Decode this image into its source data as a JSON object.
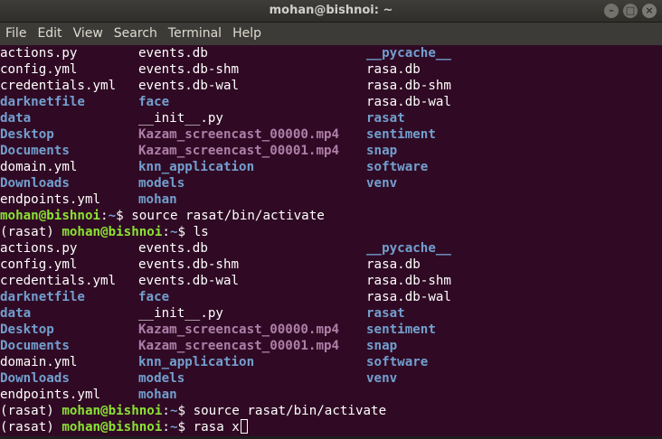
{
  "window": {
    "title": "mohan@bishnoi: ~",
    "minimize_glyph": "–",
    "maximize_glyph": "□",
    "close_glyph": "×"
  },
  "menu": [
    "File",
    "Edit",
    "View",
    "Search",
    "Terminal",
    "Help"
  ],
  "listing": [
    [
      {
        "t": "actions.py",
        "k": "file"
      },
      {
        "t": "events.db",
        "k": "file"
      },
      {
        "t": "__pycache__",
        "k": "dir"
      }
    ],
    [
      {
        "t": "config.yml",
        "k": "file"
      },
      {
        "t": "events.db-shm",
        "k": "file"
      },
      {
        "t": "rasa.db",
        "k": "file"
      }
    ],
    [
      {
        "t": "credentials.yml",
        "k": "file"
      },
      {
        "t": "events.db-wal",
        "k": "file"
      },
      {
        "t": "rasa.db-shm",
        "k": "file"
      }
    ],
    [
      {
        "t": "darknetfile",
        "k": "dir"
      },
      {
        "t": "face",
        "k": "dir"
      },
      {
        "t": "rasa.db-wal",
        "k": "file"
      }
    ],
    [
      {
        "t": "data",
        "k": "dir"
      },
      {
        "t": "__init__.py",
        "k": "file"
      },
      {
        "t": "rasat",
        "k": "dir"
      }
    ],
    [
      {
        "t": "Desktop",
        "k": "dir"
      },
      {
        "t": "Kazam_screencast_00000.mp4",
        "k": "vid"
      },
      {
        "t": "sentiment",
        "k": "dir"
      }
    ],
    [
      {
        "t": "Documents",
        "k": "dir"
      },
      {
        "t": "Kazam_screencast_00001.mp4",
        "k": "vid"
      },
      {
        "t": "snap",
        "k": "dir"
      }
    ],
    [
      {
        "t": "domain.yml",
        "k": "file"
      },
      {
        "t": "knn_application",
        "k": "dir"
      },
      {
        "t": "software",
        "k": "dir"
      }
    ],
    [
      {
        "t": "Downloads",
        "k": "dir"
      },
      {
        "t": "models",
        "k": "dir"
      },
      {
        "t": "venv",
        "k": "dir"
      }
    ],
    [
      {
        "t": "endpoints.yml",
        "k": "file"
      },
      {
        "t": "mohan",
        "k": "dir"
      },
      null
    ]
  ],
  "prompt": {
    "host": "mohan@bishnoi",
    "sep": ":",
    "path": "~",
    "symbol": "$ "
  },
  "session": [
    {
      "type": "listing"
    },
    {
      "type": "prompt",
      "env": "",
      "cmd": "source rasat/bin/activate"
    },
    {
      "type": "prompt",
      "env": "(rasat) ",
      "cmd": "ls"
    },
    {
      "type": "listing"
    },
    {
      "type": "prompt",
      "env": "(rasat) ",
      "cmd": "source rasat/bin/activate"
    },
    {
      "type": "prompt",
      "env": "(rasat) ",
      "cmd": "rasa x",
      "cursor": true
    }
  ]
}
